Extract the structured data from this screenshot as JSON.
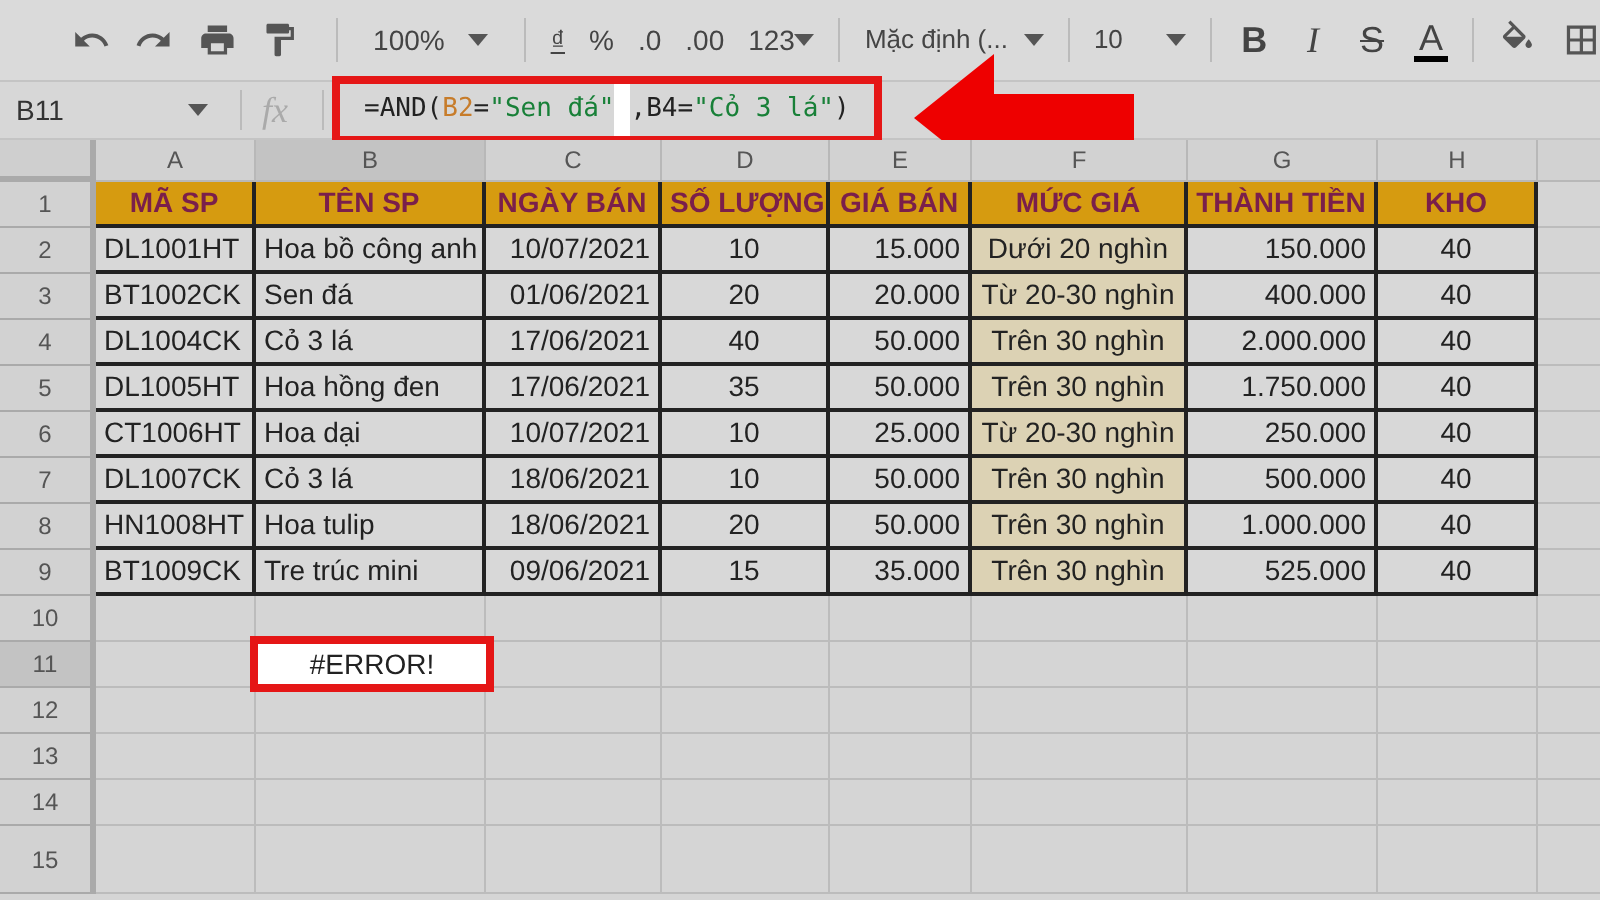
{
  "toolbar": {
    "zoom": "100%",
    "format_items": [
      "₫",
      "%",
      ".0",
      ".00",
      "123"
    ],
    "font": "Mặc định (...",
    "font_size": "10",
    "style_buttons": [
      "B",
      "I",
      "S",
      "A"
    ]
  },
  "formula_bar": {
    "cell_ref": "B11",
    "fx": "fx",
    "highlighted": true,
    "segments": [
      {
        "kind": "plain",
        "text": "=AND("
      },
      {
        "kind": "ref",
        "text": "B2"
      },
      {
        "kind": "plain",
        "text": "="
      },
      {
        "kind": "string",
        "text": "\"Sen đá\""
      },
      {
        "kind": "cursor"
      },
      {
        "kind": "plain",
        "text": ",B4="
      },
      {
        "kind": "string",
        "text": "\"Cỏ 3 lá\""
      },
      {
        "kind": "plain",
        "text": ")"
      }
    ]
  },
  "annotation": {
    "arrow": true
  },
  "columns": [
    {
      "label": "A",
      "selected": false
    },
    {
      "label": "B",
      "selected": true
    },
    {
      "label": "C",
      "selected": false
    },
    {
      "label": "D",
      "selected": false
    },
    {
      "label": "E",
      "selected": false
    },
    {
      "label": "F",
      "selected": false
    },
    {
      "label": "G",
      "selected": false
    },
    {
      "label": "H",
      "selected": false
    }
  ],
  "rows": [
    {
      "number": "1",
      "selected": false,
      "kind": "header",
      "cells": [
        "MÃ SP",
        "TÊN SP",
        "NGÀY BÁN",
        "SỐ LƯỢNG",
        "GIÁ BÁN",
        "MỨC GIÁ",
        "THÀNH TIỀN",
        "KHO"
      ]
    },
    {
      "number": "2",
      "selected": false,
      "kind": "data",
      "cells": [
        "DL1001HT",
        "Hoa bồ công anh",
        "10/07/2021",
        "10",
        "15.000",
        "Dưới 20 nghìn",
        "150.000",
        "40"
      ]
    },
    {
      "number": "3",
      "selected": false,
      "kind": "data",
      "cells": [
        "BT1002CK",
        "Sen đá",
        "01/06/2021",
        "20",
        "20.000",
        "Từ 20-30 nghìn",
        "400.000",
        "40"
      ]
    },
    {
      "number": "4",
      "selected": false,
      "kind": "data",
      "cells": [
        "DL1004CK",
        "Cỏ 3 lá",
        "17/06/2021",
        "40",
        "50.000",
        "Trên 30 nghìn",
        "2.000.000",
        "40"
      ]
    },
    {
      "number": "5",
      "selected": false,
      "kind": "data",
      "cells": [
        "DL1005HT",
        "Hoa hồng đen",
        "17/06/2021",
        "35",
        "50.000",
        "Trên 30 nghìn",
        "1.750.000",
        "40"
      ]
    },
    {
      "number": "6",
      "selected": false,
      "kind": "data",
      "cells": [
        "CT1006HT",
        "Hoa dại",
        "10/07/2021",
        "10",
        "25.000",
        "Từ 20-30 nghìn",
        "250.000",
        "40"
      ]
    },
    {
      "number": "7",
      "selected": false,
      "kind": "data",
      "cells": [
        "DL1007CK",
        "Cỏ 3 lá",
        "18/06/2021",
        "10",
        "50.000",
        "Trên 30 nghìn",
        "500.000",
        "40"
      ]
    },
    {
      "number": "8",
      "selected": false,
      "kind": "data",
      "cells": [
        "HN1008HT",
        "Hoa tulip",
        "18/06/2021",
        "20",
        "50.000",
        "Trên 30 nghìn",
        "1.000.000",
        "40"
      ]
    },
    {
      "number": "9",
      "selected": false,
      "kind": "data",
      "cells": [
        "BT1009CK",
        "Tre trúc mini",
        "09/06/2021",
        "15",
        "35.000",
        "Trên 30 nghìn",
        "525.000",
        "40"
      ]
    },
    {
      "number": "10",
      "selected": false,
      "kind": "blank"
    },
    {
      "number": "11",
      "selected": true,
      "kind": "blank",
      "active_cell": {
        "value": "#ERROR!",
        "highlighted": true
      }
    },
    {
      "number": "12",
      "selected": false,
      "kind": "blank"
    },
    {
      "number": "13",
      "selected": false,
      "kind": "blank"
    },
    {
      "number": "14",
      "selected": false,
      "kind": "blank"
    },
    {
      "number": "15",
      "selected": false,
      "kind": "blank"
    }
  ]
}
